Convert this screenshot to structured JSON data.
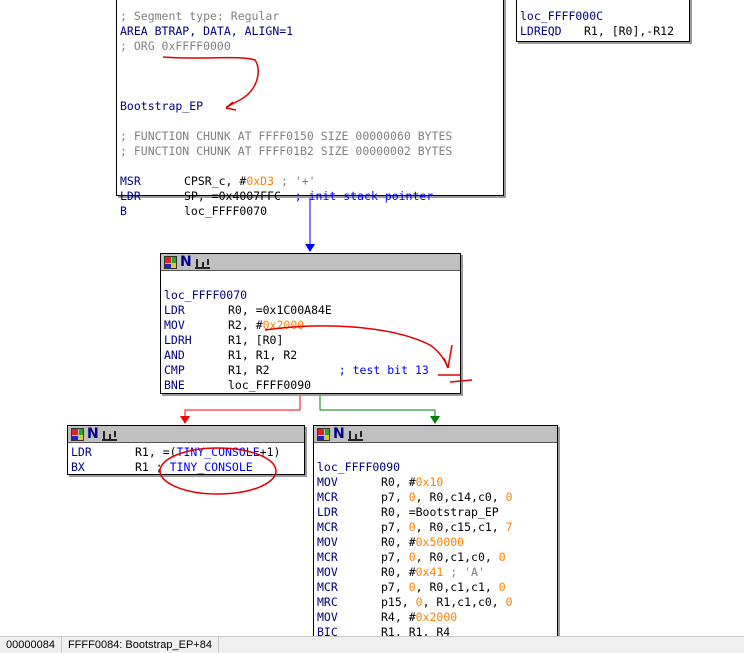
{
  "colors": {
    "mnemonic": "#000080",
    "comment": "#808080",
    "immediate": "#ff8000",
    "symbol": "#0000ff",
    "edge_true": "#008000",
    "edge_false": "#ff0000",
    "edge_flow": "#0000ff",
    "annotation": "#e00000"
  },
  "icons": [
    "color-palette-icon",
    "n-mode-icon",
    "graph-overview-icon"
  ],
  "node_entry": {
    "lines": [
      {
        "c": "; Segment type: Regular",
        "t": "cmt"
      },
      {
        "c": "AREA BTRAP, DATA, ALIGN=1",
        "t": "lbl"
      },
      {
        "c": "; ORG 0xFFFF0000",
        "t": "cmt"
      },
      {
        "c": "",
        "t": "blank"
      },
      {
        "c": "",
        "t": "blank"
      },
      {
        "c": "",
        "t": "blank"
      },
      {
        "c": "Bootstrap_EP",
        "t": "lbl"
      },
      {
        "c": "",
        "t": "blank"
      },
      {
        "c": "; FUNCTION CHUNK AT FFFF0150 SIZE 00000060 BYTES",
        "t": "cmt"
      },
      {
        "c": "; FUNCTION CHUNK AT FFFF01B2 SIZE 00000002 BYTES",
        "t": "cmt"
      },
      {
        "c": "",
        "t": "blank"
      },
      {
        "op": "MSR",
        "a": [
          [
            "CPSR_c, ",
            ""
          ],
          [
            "#",
            ""
          ],
          [
            "0xD3",
            "num"
          ],
          [
            " ; '+'",
            "cmt"
          ]
        ]
      },
      {
        "op": "LDR",
        "a": [
          [
            "SP, =0x4007FFC",
            ""
          ],
          [
            "  ; init stack pointer",
            "rcmt"
          ]
        ]
      },
      {
        "op": "B",
        "a": [
          [
            "loc_FFFF0070",
            ""
          ]
        ]
      }
    ]
  },
  "node_top_right": {
    "lines": [
      {
        "c": "loc_FFFF000C",
        "t": "lbl"
      },
      {
        "op": "LDREQD",
        "a": [
          [
            "R1, [R0],-R12",
            ""
          ]
        ]
      }
    ]
  },
  "node_loop": {
    "lines": [
      {
        "c": "",
        "t": "blank"
      },
      {
        "c": "loc_FFFF0070",
        "t": "lbl"
      },
      {
        "op": "LDR",
        "a": [
          [
            "R0, =0x1C00A84E",
            ""
          ]
        ]
      },
      {
        "op": "MOV",
        "a": [
          [
            "R2, #",
            ""
          ],
          [
            "0x2000",
            "num"
          ]
        ]
      },
      {
        "op": "LDRH",
        "a": [
          [
            "R1, [R0]",
            ""
          ]
        ]
      },
      {
        "op": "AND",
        "a": [
          [
            "R1, R1, R2",
            ""
          ]
        ]
      },
      {
        "op": "CMP",
        "a": [
          [
            "R1, R2",
            ""
          ],
          [
            "          ; test bit 13",
            "rcmt"
          ]
        ]
      },
      {
        "op": "BNE",
        "a": [
          [
            "loc_FFFF0090",
            ""
          ]
        ]
      }
    ]
  },
  "node_console": {
    "lines": [
      {
        "op": "LDR",
        "a": [
          [
            "R1, =(",
            ""
          ],
          [
            "TINY_CONSOLE",
            "sym"
          ],
          [
            "+1)",
            ""
          ]
        ]
      },
      {
        "op": "BX",
        "a": [
          [
            "R1 ; ",
            ""
          ],
          [
            "TINY_CONSOLE",
            "sym"
          ]
        ]
      }
    ]
  },
  "node_init": {
    "lines": [
      {
        "c": "",
        "t": "blank"
      },
      {
        "c": "loc_FFFF0090",
        "t": "lbl"
      },
      {
        "op": "MOV",
        "a": [
          [
            "R0, #",
            ""
          ],
          [
            "0x10",
            "num"
          ]
        ]
      },
      {
        "op": "MCR",
        "a": [
          [
            "p7, ",
            ""
          ],
          [
            "0",
            "num"
          ],
          [
            ", R0,c14,c0, ",
            ""
          ],
          [
            "0",
            "num"
          ]
        ]
      },
      {
        "op": "LDR",
        "a": [
          [
            "R0, =Bootstrap_EP",
            ""
          ]
        ]
      },
      {
        "op": "MCR",
        "a": [
          [
            "p7, ",
            ""
          ],
          [
            "0",
            "num"
          ],
          [
            ", R0,c15,c1, ",
            ""
          ],
          [
            "7",
            "num"
          ]
        ]
      },
      {
        "op": "MOV",
        "a": [
          [
            "R0, #",
            ""
          ],
          [
            "0x50000",
            "num"
          ]
        ]
      },
      {
        "op": "MCR",
        "a": [
          [
            "p7, ",
            ""
          ],
          [
            "0",
            "num"
          ],
          [
            ", R0,c1,c0, ",
            ""
          ],
          [
            "0",
            "num"
          ]
        ]
      },
      {
        "op": "MOV",
        "a": [
          [
            "R0, #",
            ""
          ],
          [
            "0x41",
            "num"
          ],
          [
            " ; 'A'",
            "cmt"
          ]
        ]
      },
      {
        "op": "MCR",
        "a": [
          [
            "p7, ",
            ""
          ],
          [
            "0",
            "num"
          ],
          [
            ", R0,c1,c1, ",
            ""
          ],
          [
            "0",
            "num"
          ]
        ]
      },
      {
        "op": "MRC",
        "a": [
          [
            "p15, ",
            ""
          ],
          [
            "0",
            "num"
          ],
          [
            ", R1,c1,c0, ",
            ""
          ],
          [
            "0",
            "num"
          ]
        ]
      },
      {
        "op": "MOV",
        "a": [
          [
            "R4, #",
            ""
          ],
          [
            "0x2000",
            "num"
          ]
        ]
      },
      {
        "op": "BIC",
        "a": [
          [
            "R1, R1, R4",
            ""
          ]
        ]
      }
    ]
  },
  "status": {
    "offset": "00000084",
    "location": "FFFF0084: Bootstrap_EP+84"
  }
}
